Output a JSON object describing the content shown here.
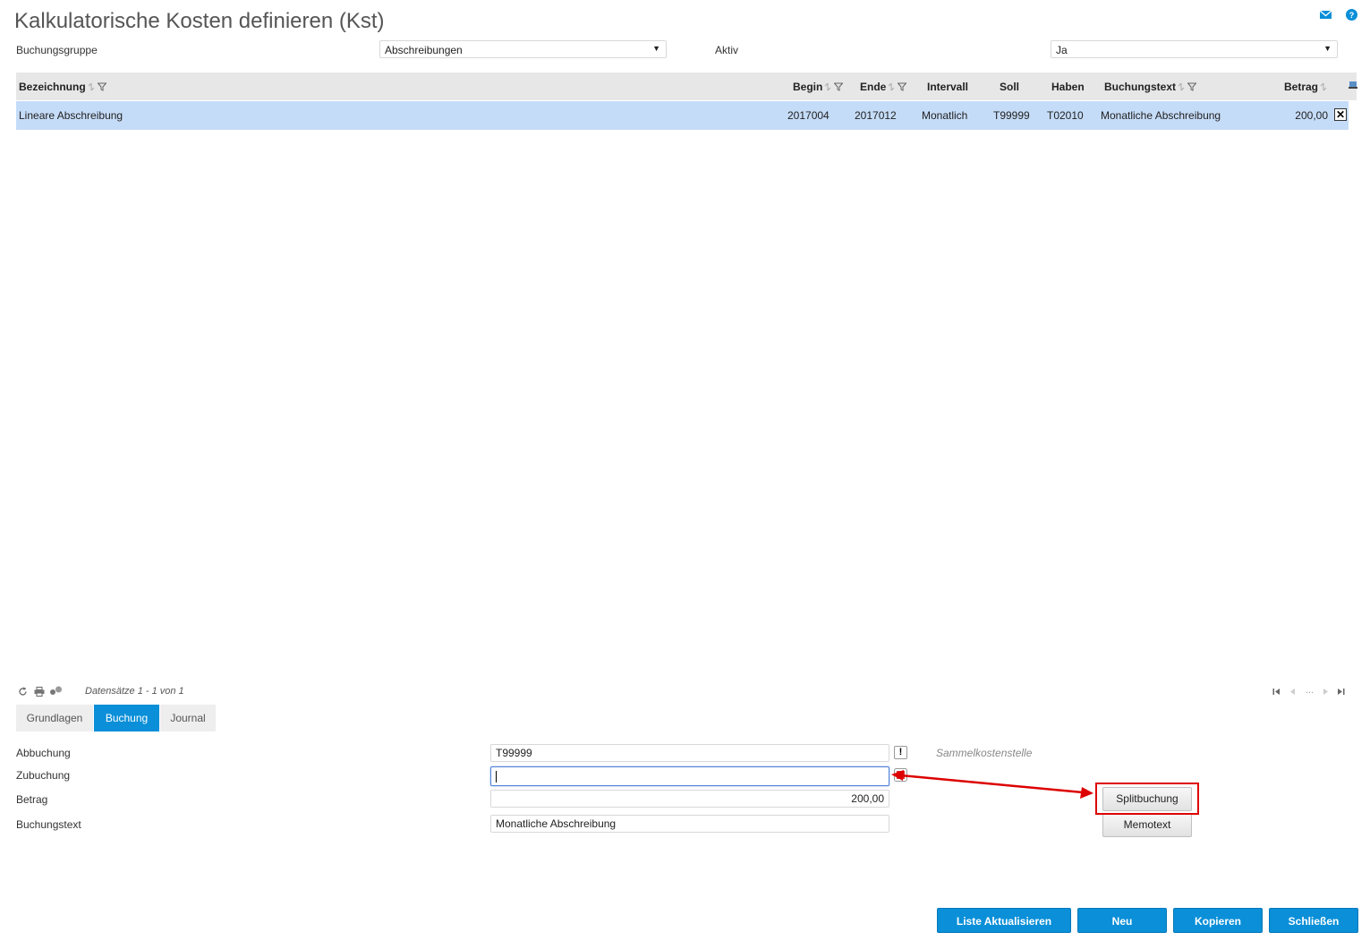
{
  "title": "Kalkulatorische Kosten definieren (Kst)",
  "icons": {
    "mail": "mail-icon",
    "help": "help-icon"
  },
  "filters": {
    "buchungsgruppe_label": "Buchungsgruppe",
    "buchungsgruppe_value": "Abschreibungen",
    "aktiv_label": "Aktiv",
    "aktiv_value": "Ja"
  },
  "grid": {
    "columns": {
      "bezeichnung": "Bezeichnung",
      "begin": "Begin",
      "ende": "Ende",
      "intervall": "Intervall",
      "soll": "Soll",
      "haben": "Haben",
      "buchungstext": "Buchungstext",
      "betrag": "Betrag"
    },
    "rows": [
      {
        "bezeichnung": "Lineare Abschreibung",
        "begin": "2017004",
        "ende": "2017012",
        "intervall": "Monatlich",
        "soll": "T99999",
        "haben": "T02010",
        "buchungstext": "Monatliche Abschreibung",
        "betrag": "200,00",
        "delete": "✕"
      }
    ]
  },
  "pager": {
    "records": "Datensätze 1 - 1 von 1",
    "ellipsis": "..."
  },
  "tabs": [
    {
      "label": "Grundlagen"
    },
    {
      "label": "Buchung",
      "active": true
    },
    {
      "label": "Journal"
    }
  ],
  "form": {
    "abbuchung_label": "Abbuchung",
    "abbuchung_value": "T99999",
    "abbuchung_btn": "!",
    "sammel_note": "Sammelkostenstelle",
    "zubuchung_label": "Zubuchung",
    "zubuchung_value": "",
    "betrag_label": "Betrag",
    "betrag_value": "200,00",
    "buchungstext_label": "Buchungstext",
    "buchungstext_value": "Monatliche Abschreibung",
    "splitbuchung": "Splitbuchung",
    "memotext": "Memotext"
  },
  "footer": {
    "liste": "Liste Aktualisieren",
    "neu": "Neu",
    "kopieren": "Kopieren",
    "schliessen": "Schließen"
  },
  "colors": {
    "accent": "#0a8fd8",
    "row_selected": "#c5dcf8",
    "annotation": "#dd0000"
  }
}
